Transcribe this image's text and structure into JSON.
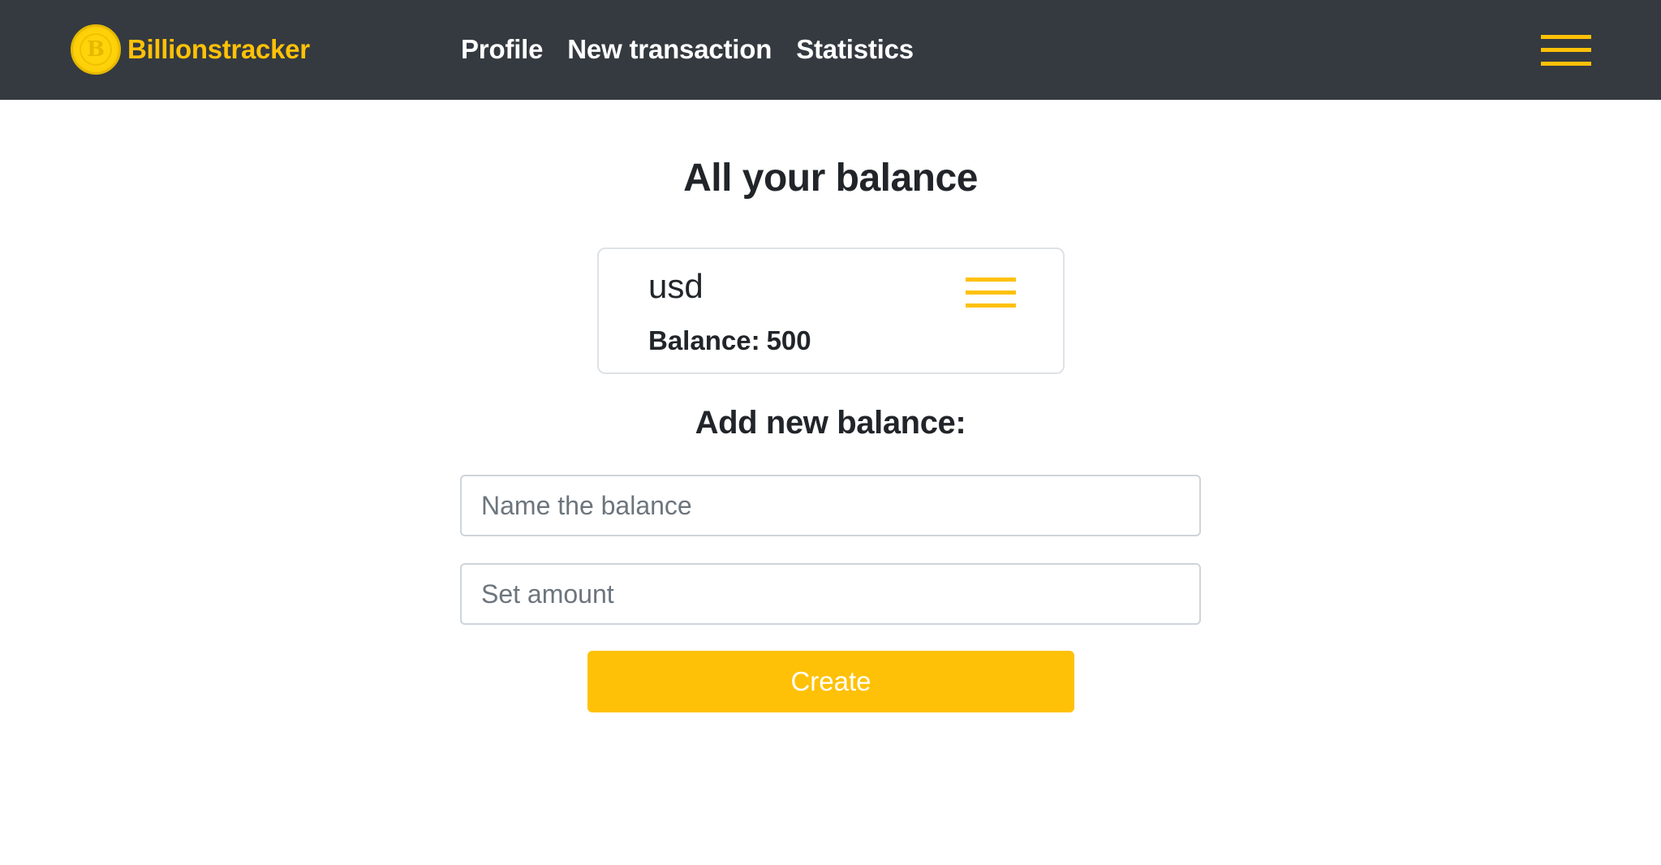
{
  "navbar": {
    "brand": {
      "name": "Billionstracker",
      "logo_letter": "B",
      "logo_icon": "coin-icon"
    },
    "links": [
      {
        "label": "Profile"
      },
      {
        "label": "New transaction"
      },
      {
        "label": "Statistics"
      }
    ],
    "menu_icon": "hamburger-menu-icon"
  },
  "main": {
    "title": "All your balance",
    "balances": [
      {
        "name": "usd",
        "balance_label": "Balance:",
        "balance_value": "500",
        "menu_icon": "hamburger-menu-icon"
      }
    ],
    "add_form": {
      "title": "Add new balance:",
      "name_field": {
        "value": "",
        "placeholder": "Name the balance"
      },
      "amount_field": {
        "value": "",
        "placeholder": "Set amount"
      },
      "submit_label": "Create"
    }
  },
  "colors": {
    "navbar_bg": "#343a40",
    "accent": "#ffc107",
    "text": "#212529",
    "border": "#dee2e6"
  }
}
